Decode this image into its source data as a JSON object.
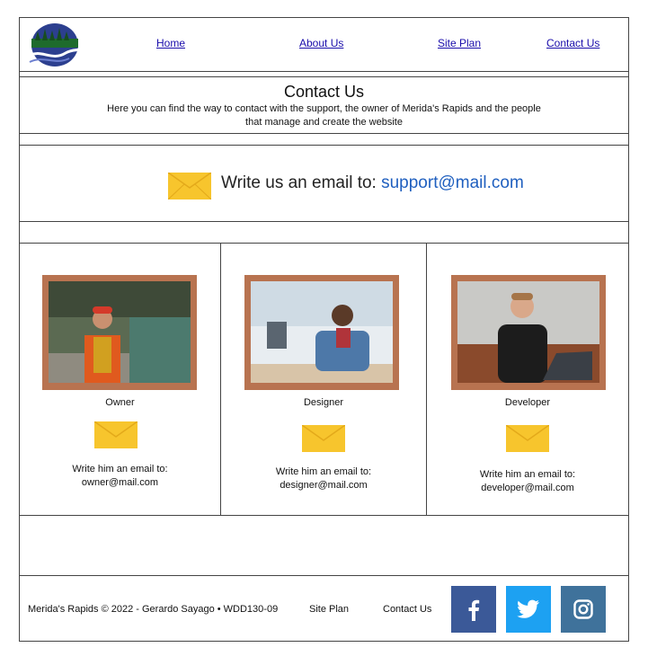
{
  "nav": {
    "home": "Home",
    "about": "About Us",
    "site_plan": "Site Plan",
    "contact": "Contact Us"
  },
  "contact": {
    "title": "Contact Us",
    "intro": "Here you can find the way to contact with the support, the owner of Merida's Rapids and the people that manage and create the website"
  },
  "support": {
    "prefix": "Write us an email to: ",
    "email": "support@mail.com"
  },
  "team": [
    {
      "role": "Owner",
      "line1": "Write him an email to:",
      "email": "owner@mail.com"
    },
    {
      "role": "Designer",
      "line1": "Write him an email to:",
      "email": "designer@mail.com"
    },
    {
      "role": "Developer",
      "line1": "Write him an email to:",
      "email": "developer@mail.com"
    }
  ],
  "footer": {
    "copyright": "Merida's Rapids © 2022 - Gerardo Sayago • WDD130-09",
    "site_plan": "Site Plan",
    "contact": "Contact Us"
  },
  "colors": {
    "facebook": "#3b5998",
    "twitter": "#1da1f2",
    "instagram": "#3f729b",
    "envelope": "#f7c52d",
    "frame": "#b87350"
  }
}
